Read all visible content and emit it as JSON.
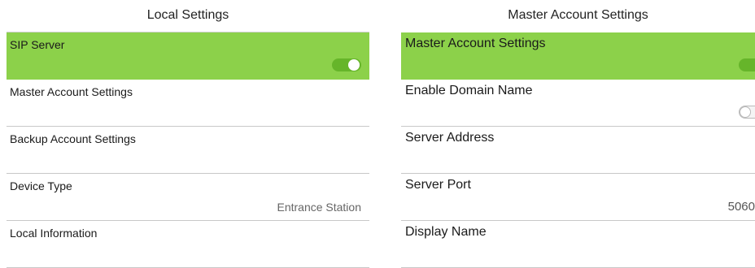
{
  "local_settings": {
    "title": "Local Settings",
    "items": [
      {
        "label": "SIP Server",
        "toggle": "on",
        "selected": true
      },
      {
        "label": "Master Account Settings"
      },
      {
        "label": "Backup Account Settings"
      },
      {
        "label": "Device Type",
        "value": "Entrance Station"
      },
      {
        "label": "Local Information"
      }
    ]
  },
  "master_account_settings": {
    "title": "Master Account Settings",
    "items": [
      {
        "label": "Master Account Settings",
        "toggle": "on",
        "selected": true
      },
      {
        "label": "Enable Domain Name",
        "toggle": "off"
      },
      {
        "label": "Server Address"
      },
      {
        "label": "Server Port",
        "value": "5060"
      },
      {
        "label": "Display Name"
      }
    ]
  },
  "colors": {
    "selected_row": "#8cd14a",
    "toggle_on": "#66b52a",
    "divider": "#c8c8c8"
  }
}
